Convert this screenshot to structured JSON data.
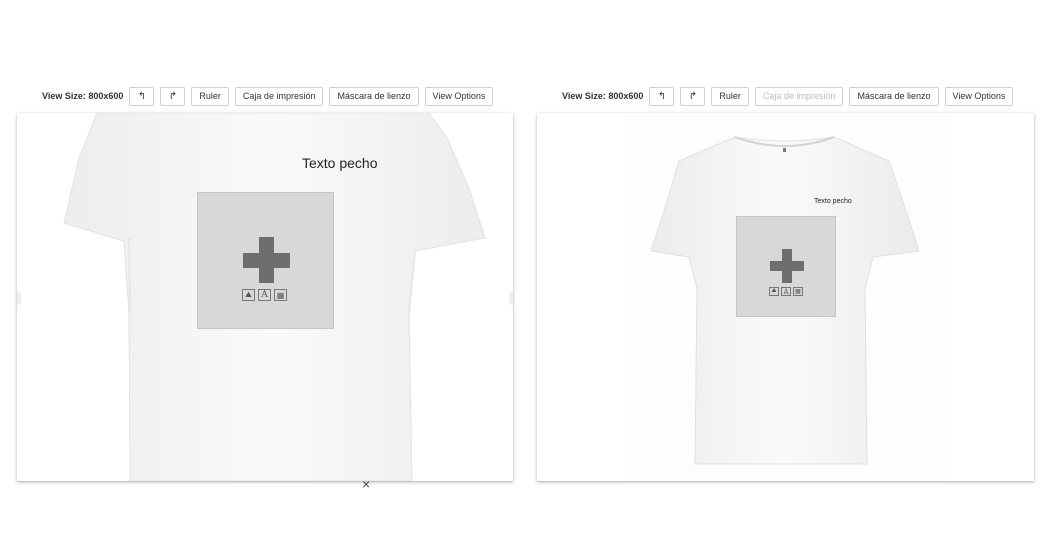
{
  "left_toolbar": {
    "view_size": "View Size: 800x600",
    "undo_glyph": "↰",
    "redo_glyph": "↱",
    "ruler": "Ruler",
    "print_box": "Caja de impresión",
    "canvas_mask": "Máscara de lienzo",
    "view_options": "View Options"
  },
  "right_toolbar": {
    "view_size": "View Size: 800x600",
    "undo_glyph": "↰",
    "redo_glyph": "↱",
    "ruler": "Ruler",
    "print_box": "Caja de impresión",
    "canvas_mask": "Máscara de lienzo",
    "view_options": "View Options"
  },
  "left_canvas": {
    "text_label": "Texto pecho"
  },
  "right_canvas": {
    "text_label": "Texto pecho"
  },
  "close_glyph": "×",
  "icons": [
    "undo-icon",
    "redo-icon",
    "plus-icon",
    "image-icon",
    "text-icon",
    "qr-icon",
    "close-icon"
  ]
}
